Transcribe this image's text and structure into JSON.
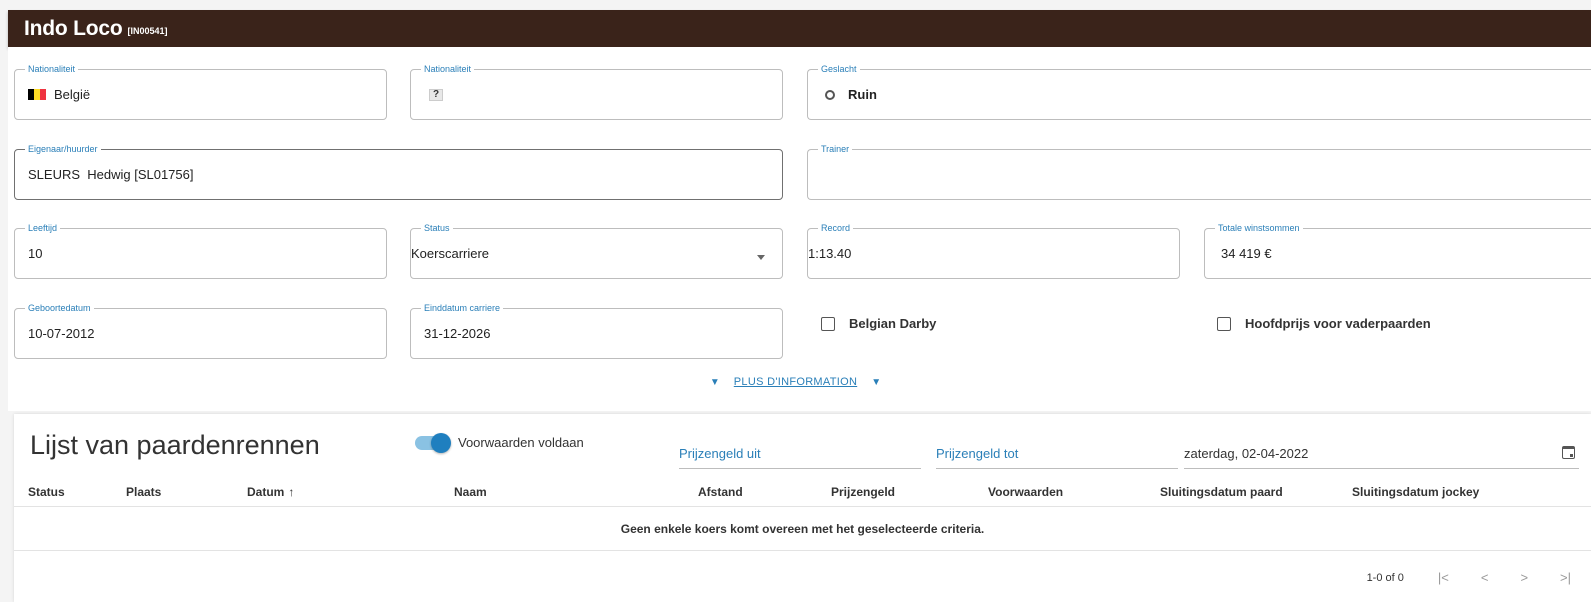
{
  "header": {
    "title": "Indo Loco",
    "code": "[IN00541]"
  },
  "fields": {
    "nationaliteit1": {
      "label": "Nationaliteit",
      "value": "België",
      "flag_colors": [
        "#000000",
        "#fdda24",
        "#ef3340"
      ]
    },
    "nationaliteit2": {
      "label": "Nationaliteit",
      "value": "?"
    },
    "geslacht": {
      "label": "Geslacht",
      "value": "Ruin"
    },
    "eigenaar": {
      "label": "Eigenaar/huurder",
      "value": "SLEURS  Hedwig [SL01756]"
    },
    "trainer": {
      "label": "Trainer",
      "value": ""
    },
    "leeftijd": {
      "label": "Leeftijd",
      "value": "10"
    },
    "status": {
      "label": "Status",
      "value": "Koerscarriere"
    },
    "record": {
      "label": "Record",
      "value": "1:13.40"
    },
    "winstsommen": {
      "label": "Totale winstsommen",
      "value": "34 419 €"
    },
    "geboortedatum": {
      "label": "Geboortedatum",
      "value": "10-07-2012"
    },
    "einddatum": {
      "label": "Einddatum carriere",
      "value": "31-12-2026"
    }
  },
  "checkboxes": {
    "belgian_darby": {
      "label": "Belgian Darby",
      "checked": false
    },
    "hoofdprijs": {
      "label": "Hoofdprijs voor vaderpaarden",
      "checked": false
    }
  },
  "more_info": {
    "label": "PLUS D'INFORMATION"
  },
  "races": {
    "title": "Lijst van paardenrennen",
    "toggle": {
      "label": "Voorwaarden voldaan",
      "on": true
    },
    "filters": {
      "prize_from": "Prijzengeld uit",
      "prize_to": "Prijzengeld tot",
      "date": "zaterdag, 02-04-2022"
    },
    "columns": [
      "Status",
      "Plaats",
      "Datum",
      "Naam",
      "Afstand",
      "Prijzengeld",
      "Voorwaarden",
      "Sluitingsdatum paard",
      "Sluitingsdatum jockey"
    ],
    "sort_arrow": "↑",
    "empty_message": "Geen enkele koers komt overeen met het geselecteerde criteria.",
    "pagination": {
      "range": "1-0 of 0",
      "first": "|<",
      "prev": "<",
      "next": ">",
      "last": ">|"
    }
  },
  "colors": {
    "header_bg": "#3a231a",
    "accent": "#2a7fb8",
    "toggle": "#1f7fbf"
  }
}
